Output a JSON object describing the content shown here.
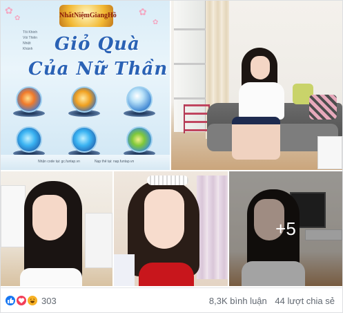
{
  "post": {
    "tiles": [
      {
        "id": "promo",
        "alt_role": "promo-graphic"
      },
      {
        "id": "room"
      },
      {
        "id": "p3"
      },
      {
        "id": "p4"
      },
      {
        "id": "p5"
      }
    ],
    "promo": {
      "logo_text": "NhấtNiệmGiangHồ",
      "title_line1": "Giỏ Quà",
      "title_line2": "Của Nữ Thần",
      "side_text": "Tôi Khinh Vòi Thiên Nhiệt Khánh",
      "footer_left": "Nhận code tại: gc.funtap.vn",
      "footer_right": "Nạp thẻ tại: nap.funtap.vn"
    },
    "more_photos_label": "+5"
  },
  "reactions": {
    "icons": [
      "like-icon",
      "love-icon",
      "haha-icon"
    ],
    "colors": {
      "like": "#1877f2",
      "love": "#f33e58",
      "haha": "#f7b125"
    },
    "count": "303"
  },
  "stats": {
    "comments": "8,3K bình luận",
    "shares": "44 lượt chia sẻ"
  }
}
